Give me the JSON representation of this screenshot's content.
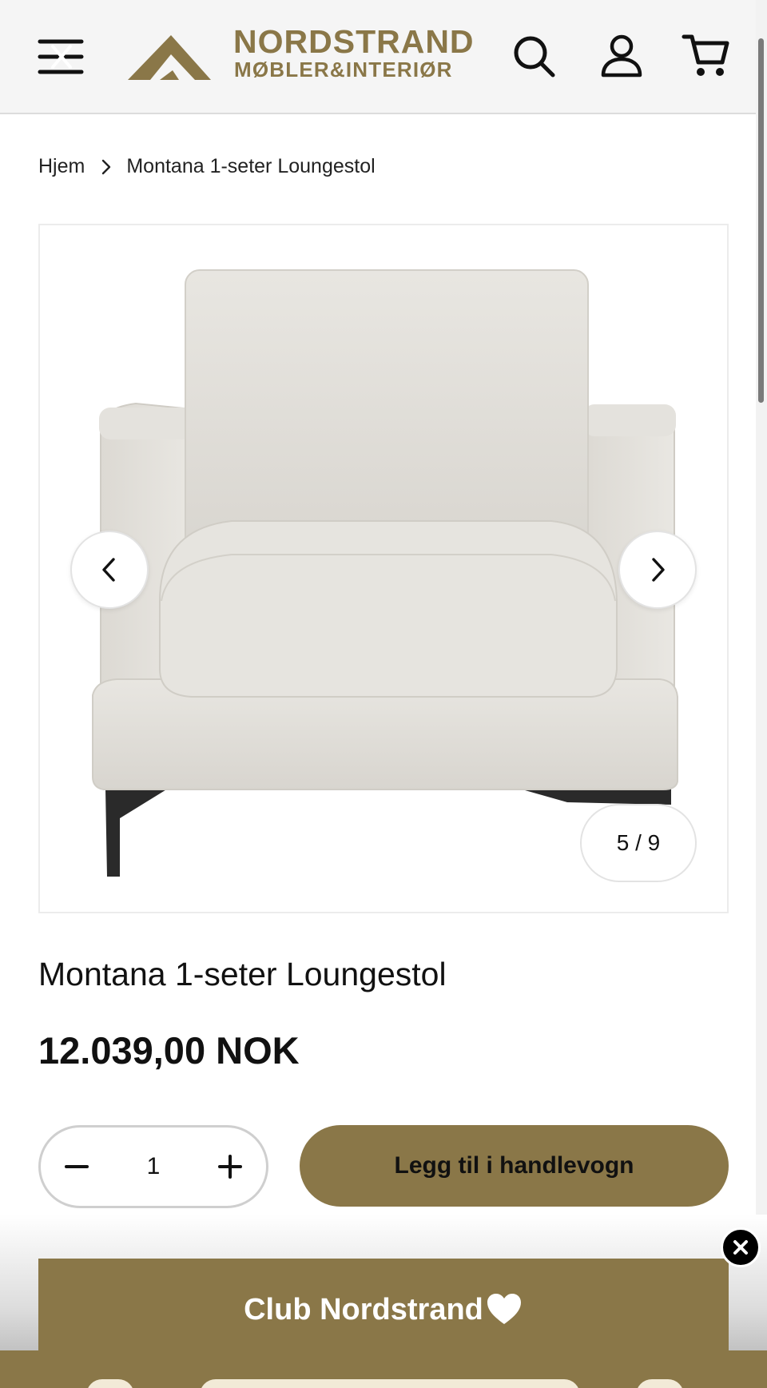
{
  "header": {
    "brand_name": "NORDSTRAND",
    "brand_sub": "MØBLER&INTERIØR",
    "icons": [
      "menu-icon",
      "search-icon",
      "account-icon",
      "cart-icon"
    ]
  },
  "breadcrumb": {
    "home": "Hjem",
    "current": "Montana 1-seter Loungestol"
  },
  "gallery": {
    "counter": "5 / 9",
    "current_index": 5,
    "total": 9
  },
  "product": {
    "title": "Montana 1-seter Loungestol",
    "price": "12.039,00 NOK"
  },
  "quantity": {
    "value": "1"
  },
  "add_to_cart": {
    "label": "Legg til i handlevogn"
  },
  "popup": {
    "title": "Club Nordstrand"
  },
  "colors": {
    "brand_gold": "#8a7748",
    "header_bg": "#f5f5f5"
  }
}
